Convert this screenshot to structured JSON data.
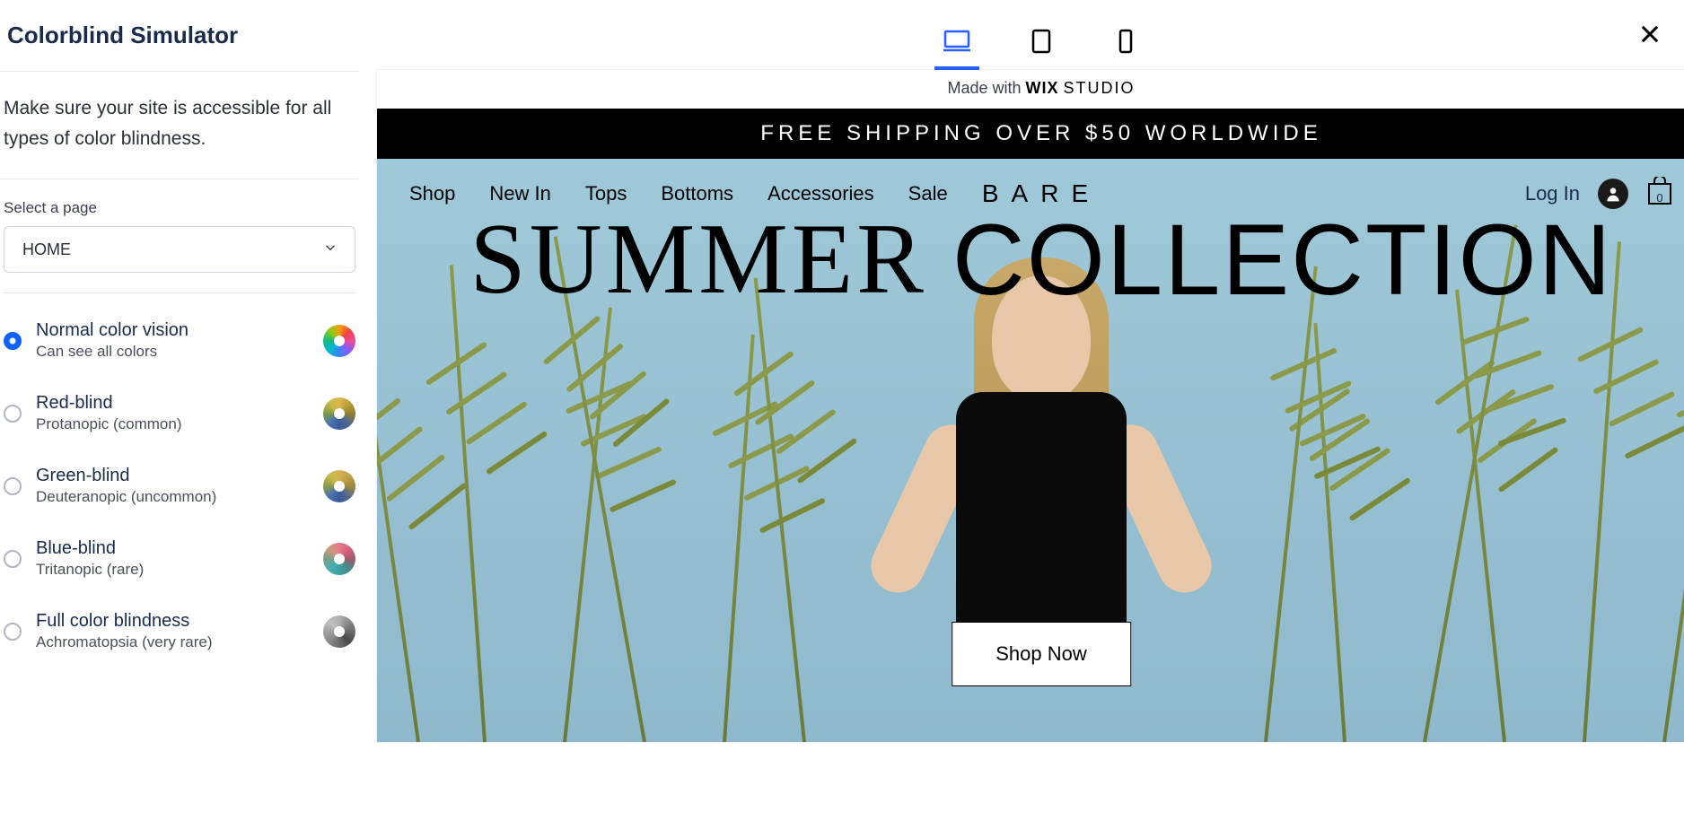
{
  "header": {
    "title": "Colorblind Simulator"
  },
  "description": "Make sure your site is accessible for all types of color blindness.",
  "page_select": {
    "label": "Select a page",
    "value": "HOME"
  },
  "options": [
    {
      "title": "Normal color vision",
      "sub": "Can see all colors",
      "selected": true,
      "wheel": "wheel-normal"
    },
    {
      "title": "Red-blind",
      "sub": "Protanopic (common)",
      "selected": false,
      "wheel": "wheel-red"
    },
    {
      "title": "Green-blind",
      "sub": "Deuteranopic (uncommon)",
      "selected": false,
      "wheel": "wheel-green"
    },
    {
      "title": "Blue-blind",
      "sub": "Tritanopic (rare)",
      "selected": false,
      "wheel": "wheel-blue"
    },
    {
      "title": "Full color blindness",
      "sub": "Achromatopsia (very rare)",
      "selected": false,
      "wheel": "wheel-full"
    }
  ],
  "devices": {
    "active": "desktop"
  },
  "preview": {
    "made_with_prefix": "Made with ",
    "made_with_brand1": "WIX",
    "made_with_brand2": "STUDIO",
    "banner": "FREE SHIPPING OVER $50 WORLDWIDE",
    "nav": [
      "Shop",
      "New In",
      "Tops",
      "Bottoms",
      "Accessories",
      "Sale"
    ],
    "brand": "BARE",
    "login": "Log In",
    "cart_count": "0",
    "hero_word1": "SUMMER",
    "hero_word2": "COLLECTION",
    "cta": "Shop Now"
  }
}
